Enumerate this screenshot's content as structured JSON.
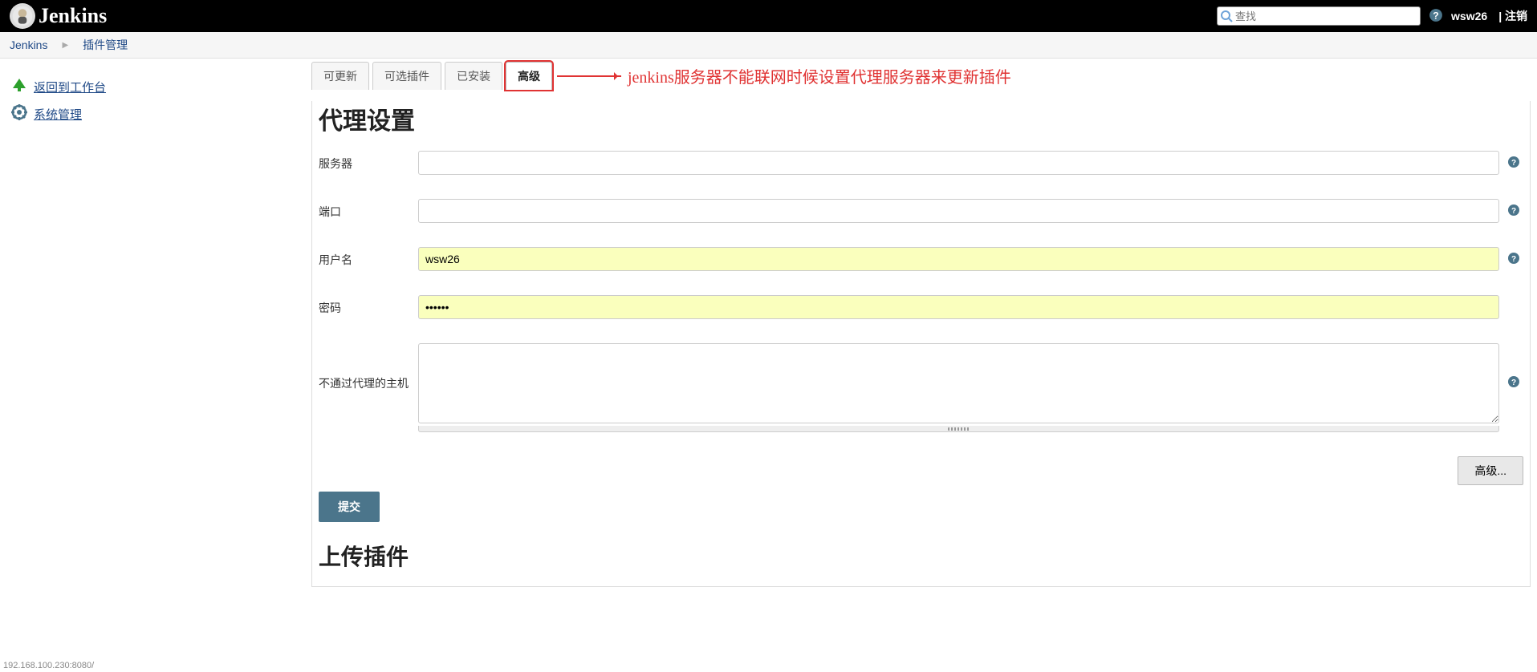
{
  "header": {
    "brand": "Jenkins",
    "search_placeholder": "查找",
    "user": "wsw26",
    "logout": "| 注销"
  },
  "breadcrumb": {
    "items": [
      "Jenkins",
      "插件管理"
    ]
  },
  "sidebar": {
    "back_dashboard": "返回到工作台",
    "manage": "系统管理"
  },
  "tabs": {
    "updatable": "可更新",
    "available": "可选插件",
    "installed": "已安装",
    "advanced": "高级"
  },
  "annotation": "jenkins服务器不能联网时候设置代理服务器来更新插件",
  "sections": {
    "proxy_title": "代理设置",
    "upload_title": "上传插件"
  },
  "form": {
    "server_label": "服务器",
    "server_value": "",
    "port_label": "端口",
    "port_value": "",
    "user_label": "用户名",
    "user_value": "wsw26",
    "password_label": "密码",
    "password_value": "••••••",
    "noproxy_label": "不通过代理的主机",
    "noproxy_value": "",
    "advanced_btn": "高级...",
    "submit_btn": "提交"
  },
  "status_text": "192.168.100.230:8080/"
}
